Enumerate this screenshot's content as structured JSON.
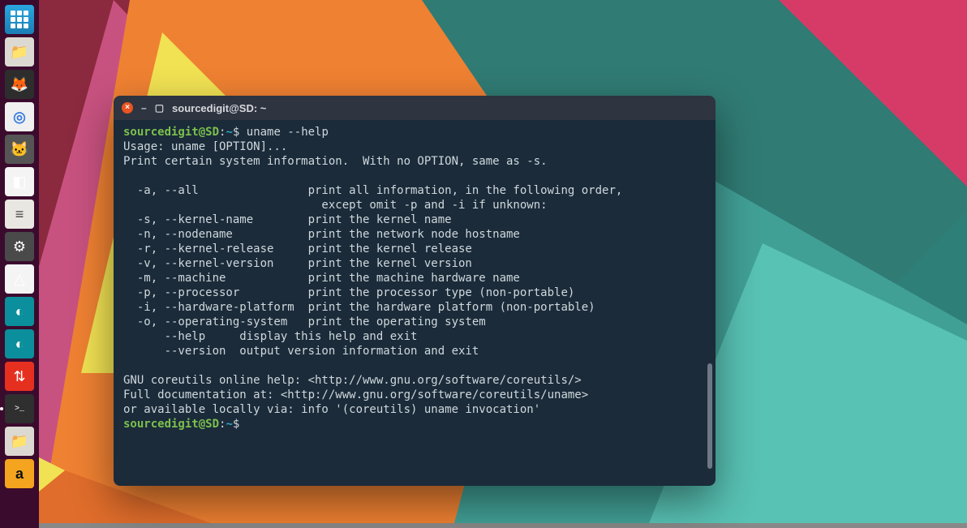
{
  "launcher": {
    "items": [
      {
        "name": "show-applications",
        "iconType": "grid"
      },
      {
        "name": "files-icon",
        "glyph": "📁"
      },
      {
        "name": "firefox-icon",
        "glyph": "🦊"
      },
      {
        "name": "chromium-icon",
        "glyph": "◎"
      },
      {
        "name": "cat-icon",
        "glyph": "🐱"
      },
      {
        "name": "libreoffice-icon",
        "glyph": "◧"
      },
      {
        "name": "tweaks-icon",
        "glyph": "≡"
      },
      {
        "name": "settings-icon",
        "glyph": "⚙"
      },
      {
        "name": "vlc-icon",
        "glyph": "△"
      },
      {
        "name": "app-p1-icon",
        "glyph": "◐"
      },
      {
        "name": "app-p2-icon",
        "glyph": "◐"
      },
      {
        "name": "transmission-icon",
        "glyph": "⇅"
      },
      {
        "name": "terminal-icon",
        "glyph": ">_"
      },
      {
        "name": "folder-icon",
        "glyph": "📁"
      },
      {
        "name": "amazon-icon",
        "glyph": "a"
      }
    ]
  },
  "window": {
    "title": "sourcedigit@SD: ~",
    "close_tooltip": "Close",
    "minimize_glyph": "–",
    "maximize_glyph": "▢"
  },
  "terminal": {
    "prompt_user": "sourcedigit@SD",
    "prompt_sep": ":",
    "prompt_path": "~",
    "prompt_symbol": "$",
    "command1": "uname --help",
    "output": "Usage: uname [OPTION]...\nPrint certain system information.  With no OPTION, same as -s.\n\n  -a, --all                print all information, in the following order,\n                             except omit -p and -i if unknown:\n  -s, --kernel-name        print the kernel name\n  -n, --nodename           print the network node hostname\n  -r, --kernel-release     print the kernel release\n  -v, --kernel-version     print the kernel version\n  -m, --machine            print the machine hardware name\n  -p, --processor          print the processor type (non-portable)\n  -i, --hardware-platform  print the hardware platform (non-portable)\n  -o, --operating-system   print the operating system\n      --help     display this help and exit\n      --version  output version information and exit\n\nGNU coreutils online help: <http://www.gnu.org/software/coreutils/>\nFull documentation at: <http://www.gnu.org/software/coreutils/uname>\nor available locally via: info '(coreutils) uname invocation'",
    "command2": ""
  }
}
